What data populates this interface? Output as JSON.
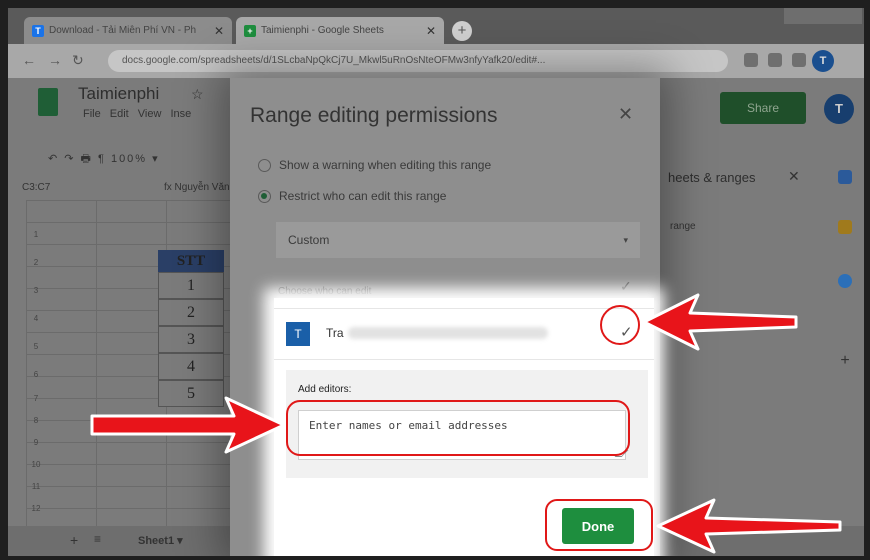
{
  "browser": {
    "tabs": [
      {
        "label": "Download - Tải Miễn Phí VN - Ph",
        "favicon": "T",
        "favicon_color": "#1a73e8"
      },
      {
        "label": "Taimienphi - Google Sheets",
        "favicon": "+",
        "favicon_color": "#1e8e3e"
      }
    ],
    "close_glyph": "✕",
    "new_tab_glyph": "+",
    "url": "docs.google.com/spreadsheets/d/1SLcbaNpQkCj7U_Mkwl5uRnOsNteOFMw3nfyYafk20/edit#...",
    "profile_initial": "T"
  },
  "sheets": {
    "title": "Taimienphi",
    "star_glyph": "☆",
    "menu": "File  Edit  View  Inse",
    "share_label": "Share",
    "user_initial": "T",
    "toolbar_text": "↶ ↷ 🖶 ¶   100% ▾",
    "cell_ref": "C3:C7",
    "formula_text": "fx   Nguyễn Văn",
    "column_header": "STT",
    "column_values": [
      "1",
      "2",
      "3",
      "4",
      "5"
    ],
    "row_numbers": [
      "1",
      "2",
      "3",
      "4",
      "5",
      "6",
      "7",
      "8",
      "9",
      "10",
      "11",
      "12"
    ],
    "sheet_tab": "Sheet1 ▾",
    "side_panel_title": "heets & ranges",
    "side_panel_range": "range",
    "side_close_glyph": "✕"
  },
  "dialog": {
    "title": "Range editing permissions",
    "close_glyph": "✕",
    "option_warning": "Show a warning when editing this range",
    "option_restrict": "Restrict who can edit this range",
    "restrict_selected": true,
    "dropdown_value": "Custom",
    "dropdown_caret": "▾",
    "choose_label": "Choose who can edit",
    "check_glyph": "✓",
    "owner": {
      "initial": "T",
      "name": "Tra"
    },
    "add_editors_label": "Add editors:",
    "add_editors_placeholder": "Enter names or email addresses",
    "done_label": "Done"
  },
  "colors": {
    "done_green": "#1e8e3e",
    "annotation_red": "#e01818",
    "avatar_blue": "#1a5fa8"
  }
}
